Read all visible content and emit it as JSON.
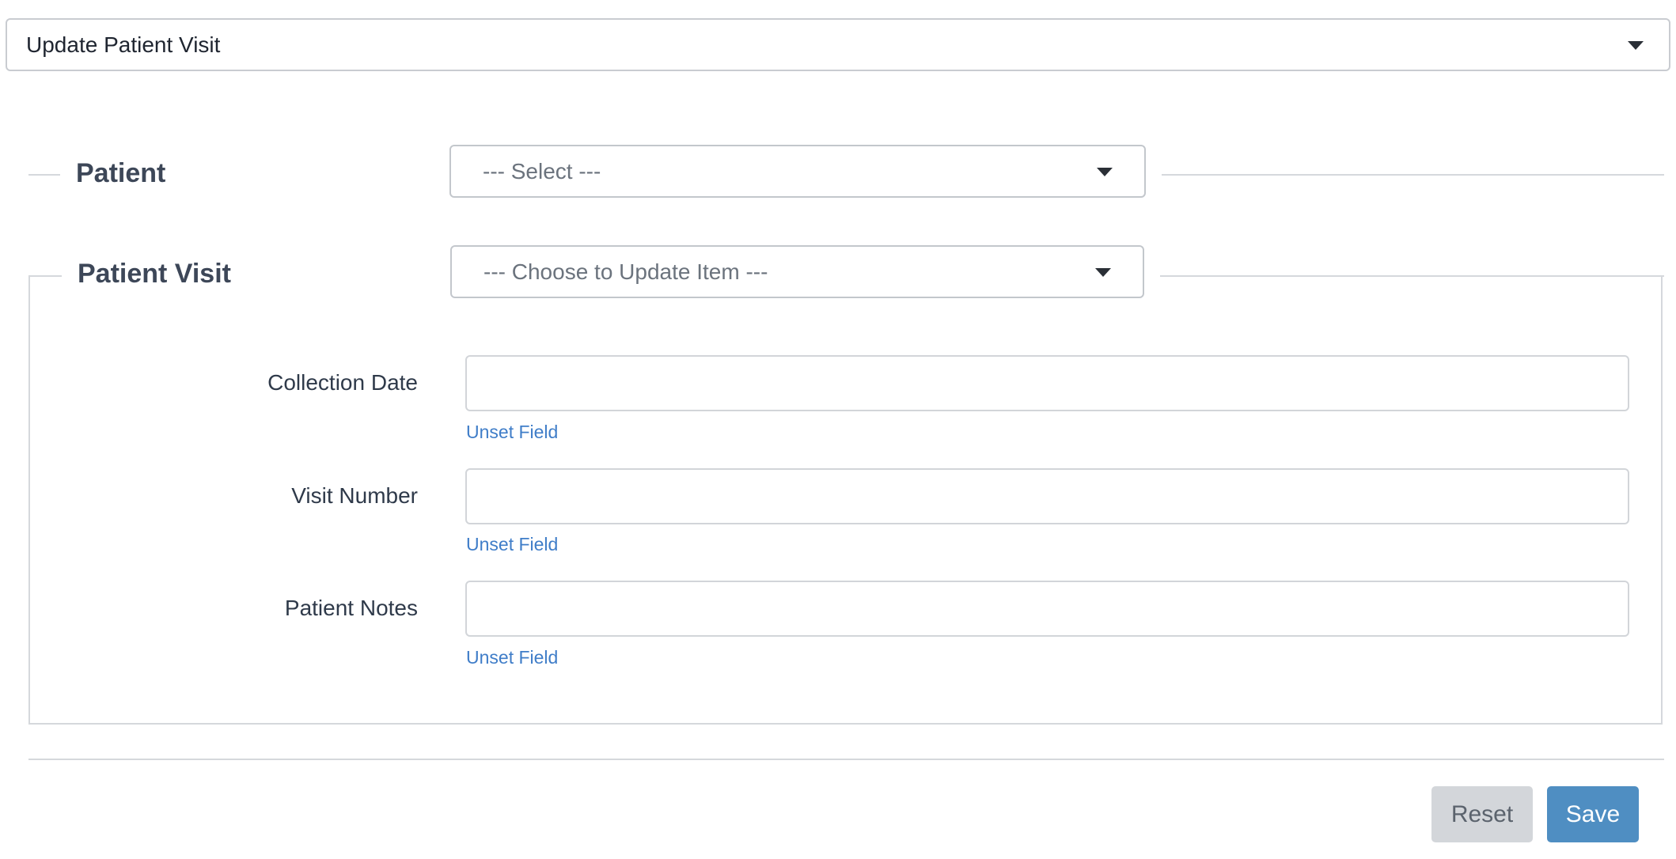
{
  "form_selector": {
    "value": "Update Patient Visit",
    "icon": "caret-down-icon"
  },
  "patient_section": {
    "legend": "Patient",
    "select_value": "--- Select ---"
  },
  "visit_section": {
    "legend": "Patient Visit",
    "select_value": "--- Choose to Update Item ---",
    "fields": [
      {
        "label": "Collection Date",
        "value": "",
        "unset_label": "Unset Field"
      },
      {
        "label": "Visit Number",
        "value": "",
        "unset_label": "Unset Field"
      },
      {
        "label": "Patient Notes",
        "value": "",
        "unset_label": "Unset Field"
      }
    ]
  },
  "actions": {
    "reset_label": "Reset",
    "save_label": "Save"
  },
  "colors": {
    "link": "#3f7dc8",
    "save_button": "#4f8ec2",
    "reset_button": "#d3d6da",
    "border": "#d5d8dc"
  }
}
